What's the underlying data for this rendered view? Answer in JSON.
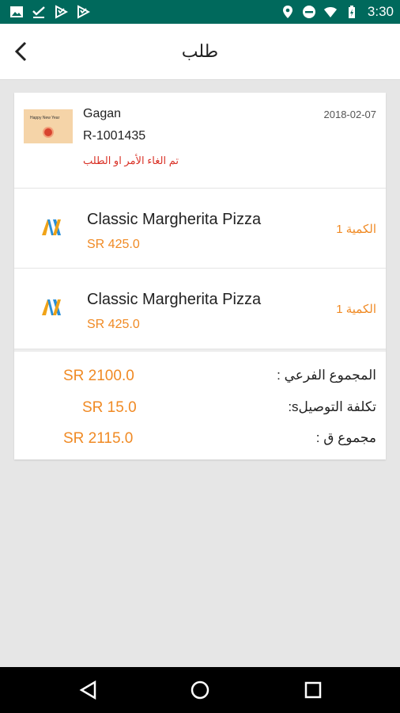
{
  "status_bar": {
    "time": "3:30",
    "left_icons": [
      "image-icon",
      "download-done-icon",
      "play-store-icon",
      "play-store-icon"
    ],
    "right_icons": [
      "location-icon",
      "do-not-disturb-icon",
      "wifi-icon",
      "battery-icon"
    ]
  },
  "app_bar": {
    "title": "طلب",
    "back_icon": "back-chevron-icon"
  },
  "order": {
    "thumb_text": "Happy New Year",
    "shop_name": "Gagan",
    "order_number": "R-1001435",
    "status": "تم الغاء الأمر او الطلب",
    "date": "2018-02-07"
  },
  "items": [
    {
      "name": "Classic Margherita Pizza",
      "price": "SR 425.0",
      "quantity": "الكمية 1"
    },
    {
      "name": "Classic Margherita Pizza",
      "price": "SR 425.0",
      "quantity": "الكمية 1"
    }
  ],
  "totals": {
    "subtotal_label": "المجموع الفرعي :",
    "subtotal_value": "SR 2100.0",
    "delivery_label": "تكلفة التوصيلs:",
    "delivery_value": "SR 15.0",
    "total_label": "مجموع ق :",
    "total_value": "SR 2115.0"
  },
  "colors": {
    "status_bar": "#00695c",
    "accent": "#f08a24",
    "status_text": "#d93025"
  }
}
